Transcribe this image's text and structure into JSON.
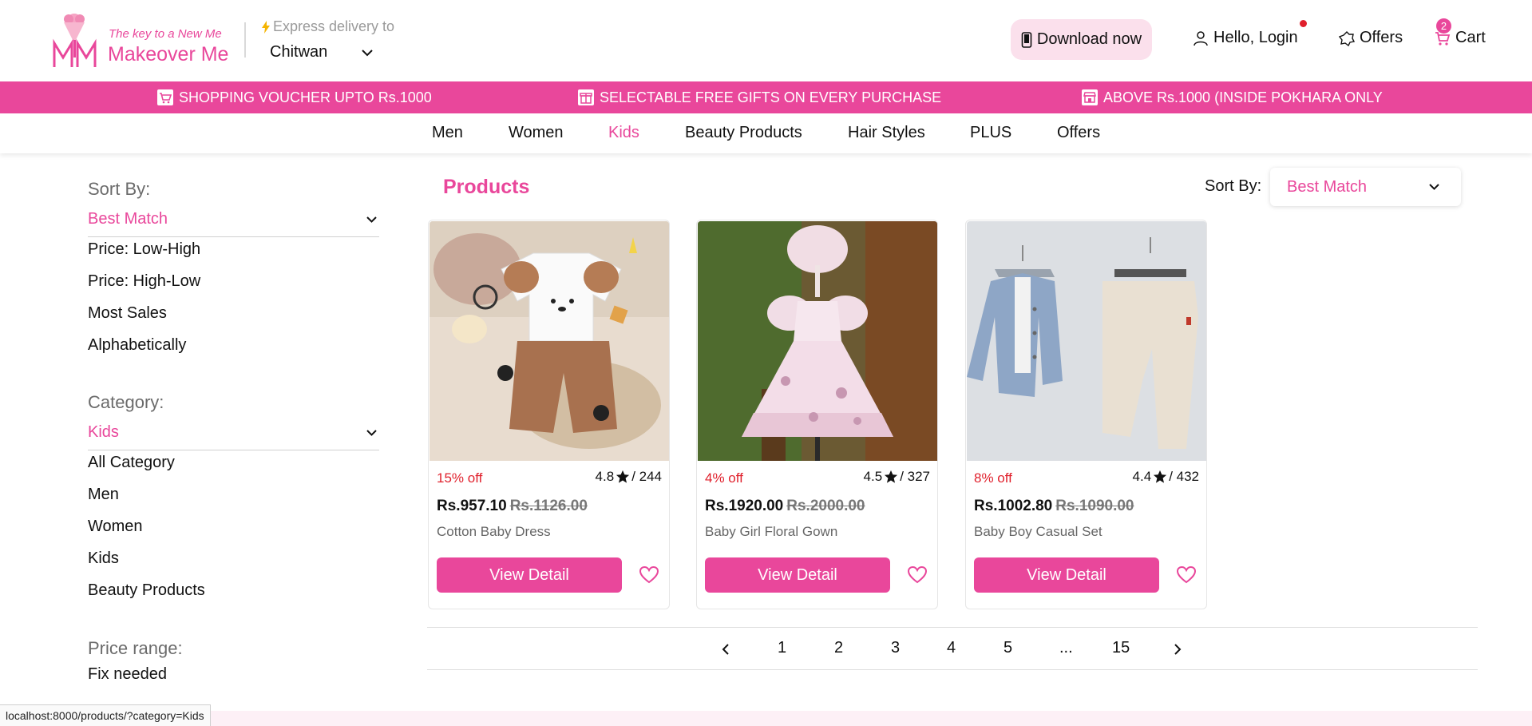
{
  "header": {
    "logo_tagline": "The key to a New Me",
    "logo_name": "Makeover Me",
    "express_label": "Express delivery to",
    "location": "Chitwan",
    "download_label": "Download now",
    "login_label": "Hello, Login",
    "offers_label": "Offers",
    "cart_label": "Cart",
    "cart_count": "2"
  },
  "promo": {
    "items": [
      "SHOPPING VOUCHER UPTO Rs.1000",
      "SELECTABLE FREE GIFTS ON EVERY PURCHASE",
      "ABOVE Rs.1000 (INSIDE POKHARA ONLY"
    ]
  },
  "nav": {
    "items": [
      "Men",
      "Women",
      "Kids",
      "Beauty Products",
      "Hair Styles",
      "PLUS",
      "Offers"
    ],
    "active": "Kids"
  },
  "sidebar": {
    "sort_heading": "Sort By:",
    "sort_selected": "Best Match",
    "sort_options": [
      "Price: Low-High",
      "Price: High-Low",
      "Most Sales",
      "Alphabetically"
    ],
    "category_heading": "Category:",
    "category_selected": "Kids",
    "category_options": [
      "All Category",
      "Men",
      "Women",
      "Kids",
      "Beauty Products"
    ],
    "price_heading": "Price range:",
    "price_value": "Fix needed"
  },
  "main": {
    "title": "Products",
    "sort_label": "Sort By:",
    "sort_value": "Best Match"
  },
  "products": [
    {
      "discount": "15% off",
      "rating": "4.8",
      "reviews": "/ 244",
      "price": "Rs.957.10",
      "old_price": "Rs.1126.00",
      "name": "Cotton Baby Dress",
      "button": "View Detail"
    },
    {
      "discount": "4% off",
      "rating": "4.5",
      "reviews": "/ 327",
      "price": "Rs.1920.00",
      "old_price": "Rs.2000.00",
      "name": "Baby Girl Floral Gown",
      "button": "View Detail"
    },
    {
      "discount": "8% off",
      "rating": "4.4",
      "reviews": "/ 432",
      "price": "Rs.1002.80",
      "old_price": "Rs.1090.00",
      "name": "Baby Boy Casual Set",
      "button": "View Detail"
    }
  ],
  "pagination": {
    "pages": [
      "1",
      "2",
      "3",
      "4",
      "5",
      "...",
      "15"
    ]
  },
  "status_bar": {
    "url": "localhost:8000/products/?category=Kids"
  },
  "colors": {
    "brand": "#e9479b",
    "brand_light": "#fbe0ec",
    "discount": "#e0202c"
  },
  "icons": [
    "bolt-icon",
    "chevron-down-icon",
    "phone-icon",
    "user-icon",
    "gift-icon",
    "cart-icon",
    "shop-icon",
    "star-icon",
    "heart-icon",
    "chevron-left-icon",
    "chevron-right-icon"
  ]
}
